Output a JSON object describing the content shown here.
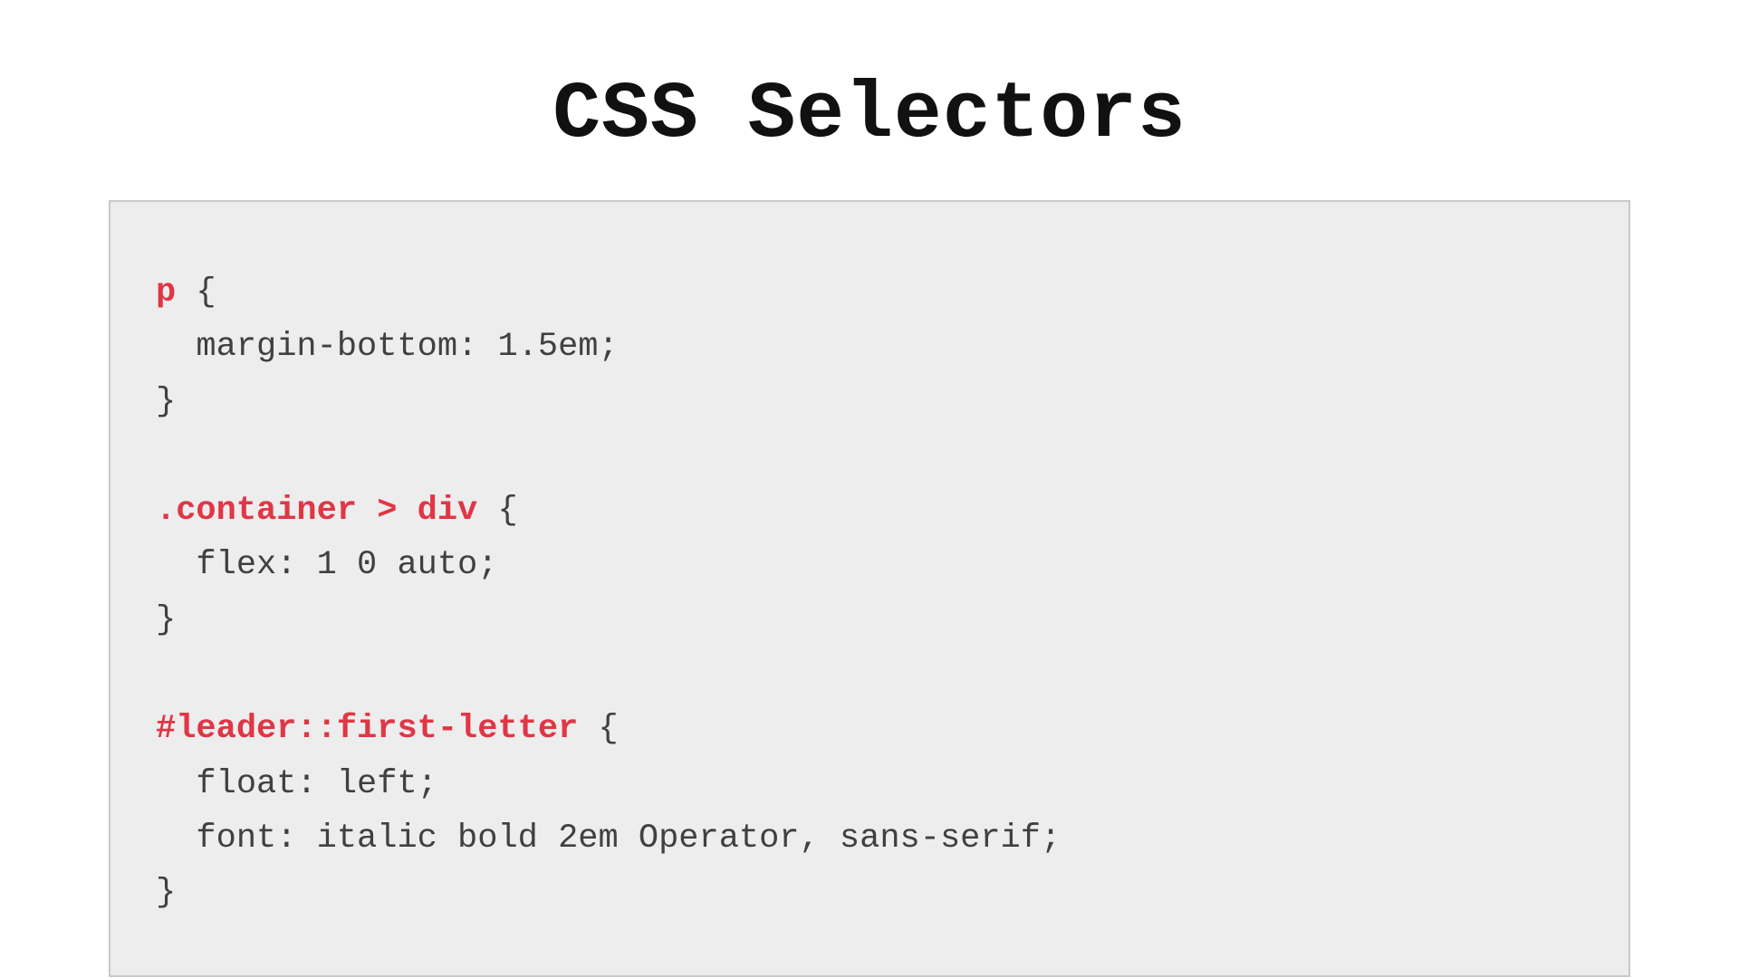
{
  "title": "CSS Selectors",
  "colors": {
    "selector": "#e03646",
    "body": "#404040",
    "box_bg": "#ededed",
    "box_border": "#c8c8c8"
  },
  "code": {
    "rules": [
      {
        "selector": "p",
        "open": " {",
        "declarations": [
          "  margin-bottom: 1.5em;"
        ],
        "close": "}"
      },
      {
        "selector": ".container > div",
        "open": " {",
        "declarations": [
          "  flex: 1 0 auto;"
        ],
        "close": "}"
      },
      {
        "selector": "#leader::first-letter",
        "open": " {",
        "declarations": [
          "  float: left;",
          "  font: italic bold 2em Operator, sans-serif;"
        ],
        "close": "}"
      }
    ]
  }
}
